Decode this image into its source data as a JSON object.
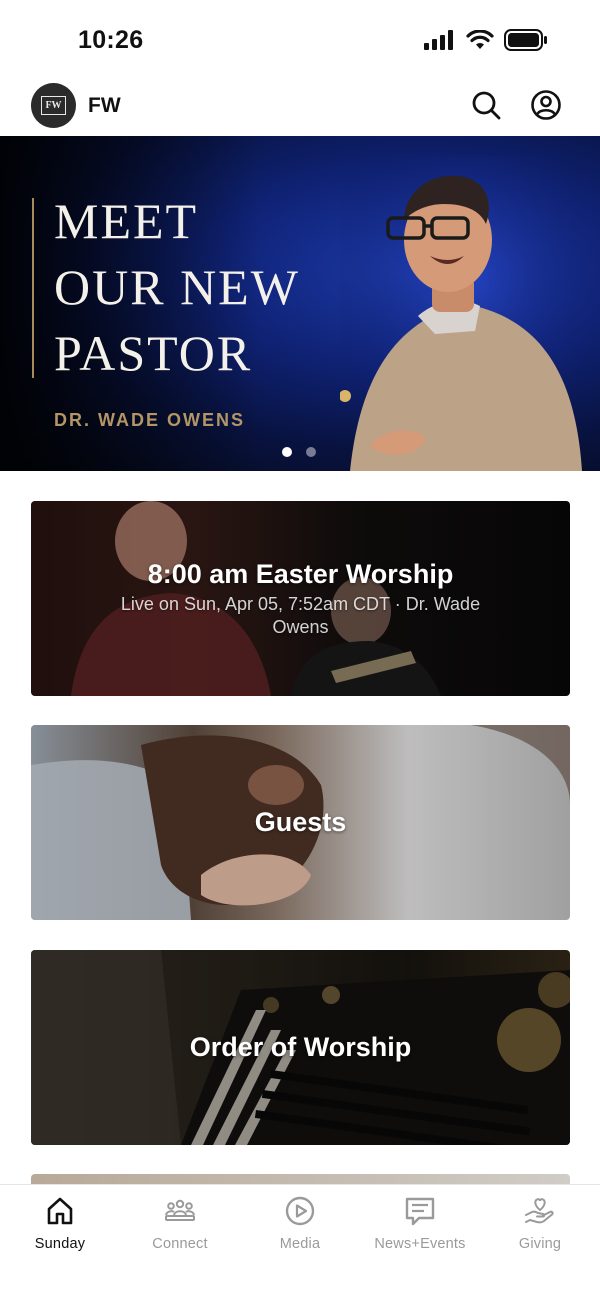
{
  "status_bar": {
    "time": "10:26"
  },
  "header": {
    "logo_text": "FW",
    "title": "FW"
  },
  "hero": {
    "title_lines": [
      "MEET",
      "OUR NEW",
      "PASTOR"
    ],
    "subtitle": "DR. WADE OWENS",
    "slides_total": 2,
    "active_slide": 1
  },
  "cards": [
    {
      "title": "8:00 am Easter Worship",
      "meta": "Live on Sun, Apr 05, 7:52am CDT · Dr. Wade Owens"
    },
    {
      "title": "Guests"
    },
    {
      "title": "Order of Worship"
    }
  ],
  "tabs": [
    {
      "label": "Sunday",
      "icon": "home-icon",
      "active": true
    },
    {
      "label": "Connect",
      "icon": "people-icon"
    },
    {
      "label": "Media",
      "icon": "play-icon"
    },
    {
      "label": "News+Events",
      "icon": "message-icon"
    },
    {
      "label": "Giving",
      "icon": "heart-hand-icon"
    }
  ],
  "colors": {
    "hero_accent": "#b39566",
    "tab_active": "#111111",
    "tab_inactive": "#9a9a9a"
  }
}
